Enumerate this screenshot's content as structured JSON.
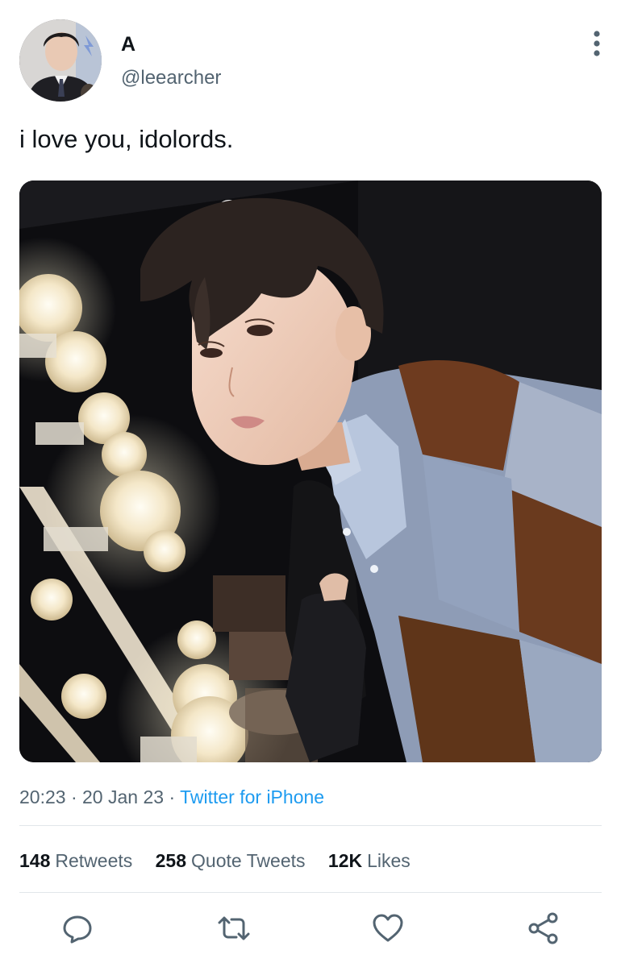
{
  "tweet": {
    "display_name": "A",
    "handle": "@leearcher",
    "text": "i love you, idolords.",
    "time": "20:23",
    "date": "20 Jan 23",
    "separator": "·",
    "source": "Twitter for iPhone"
  },
  "stats": [
    {
      "count": "148",
      "label": "Retweets"
    },
    {
      "count": "258",
      "label": "Quote Tweets"
    },
    {
      "count": "12K",
      "label": "Likes"
    }
  ],
  "icons": {
    "more": "more-vertical-icon",
    "reply": "reply-icon",
    "retweet": "retweet-icon",
    "like": "heart-icon",
    "share": "share-icon"
  },
  "colors": {
    "text": "#0f1419",
    "secondary": "#536471",
    "link": "#1d9bf0",
    "divider": "#e1e6ea",
    "icon": "#536471"
  }
}
